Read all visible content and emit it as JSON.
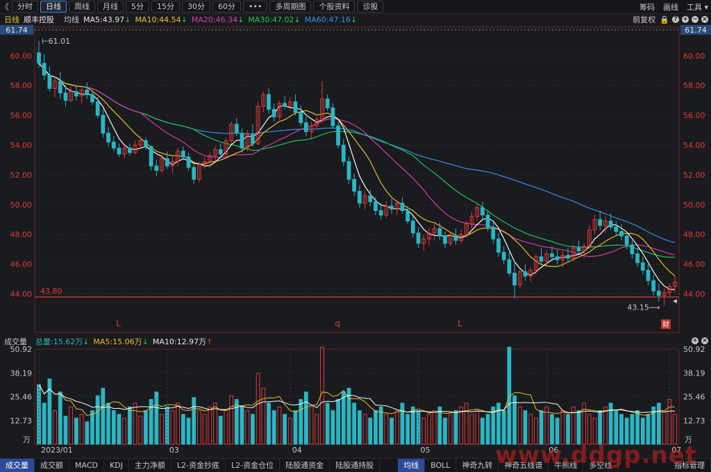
{
  "toolbar": {
    "back": "《",
    "tabs": [
      "分时",
      "日线",
      "周线",
      "月线",
      "5分",
      "15分",
      "30分",
      "60分",
      "•••",
      "多周期图",
      "个股资料",
      "诊股"
    ],
    "active_tab": "日线",
    "right_items": [
      "筹码",
      "画线",
      "工具 ▾"
    ]
  },
  "ma_bar": {
    "period": "日线",
    "stock": "顺丰控股",
    "label": "均线",
    "ma5": "MA5:43.97",
    "ma10": "MA10:44.54",
    "ma20": "MA20:46.34",
    "ma30": "MA30:47.02",
    "ma60": "MA60:47.16",
    "adjust": "前复权"
  },
  "colors": {
    "up": "#e03a3a",
    "down": "#2bb6c4",
    "ma5": "#ffffff",
    "ma10": "#e8c22a",
    "ma20": "#d23ea6",
    "ma30": "#22c55a",
    "ma60": "#3a8ee6",
    "vol_total": "#2bb6c4"
  },
  "price_axis": {
    "ticks": [
      "61.74",
      "60.00",
      "58.00",
      "56.00",
      "54.00",
      "52.00",
      "50.00",
      "48.00",
      "46.00",
      "44.00"
    ],
    "top_label": "61.74"
  },
  "annotations": {
    "high": "61.01",
    "low": "43.15",
    "hline_label": "43.80",
    "markers": [
      "L",
      "q",
      "L"
    ],
    "fin_badge": "财"
  },
  "volume_bar": {
    "label": "成交量",
    "total": "总量:15.62万",
    "ma5": "MA5:15.06万",
    "ma10": "MA10:12.97万"
  },
  "volume_axis": {
    "ticks": [
      "50.92",
      "38.19",
      "25.46",
      "12.73"
    ],
    "unit": "万"
  },
  "x_axis": {
    "labels": [
      "2023/01",
      "03",
      "04",
      "05",
      "06",
      "07",
      "08"
    ]
  },
  "bottom_tabs": [
    "成交量",
    "成交额",
    "MACD",
    "KDJ",
    "主力净额",
    "L2-资金抄底",
    "L2-资金仓位",
    "陆股通资金",
    "陆股通持股",
    "均线",
    "BOLL",
    "神奇九转",
    "神奇五线谱",
    "牛熊线",
    "多空线",
    "指标管理"
  ],
  "watermark": "www.ddgp.net",
  "chart_data": {
    "type": "candlestick",
    "title": "顺丰控股 日线",
    "ylim": [
      43.0,
      61.74
    ],
    "vol_ylim": [
      0,
      50.92
    ],
    "x": [
      "2023/01",
      "",
      "",
      "",
      "",
      "",
      "",
      "",
      "",
      "",
      "",
      "",
      "",
      "",
      "",
      "",
      "",
      "",
      "",
      "",
      "",
      "",
      "",
      "",
      "03",
      "",
      "",
      "",
      "",
      "",
      "",
      "",
      "",
      "",
      "",
      "",
      "",
      "",
      "",
      "",
      "",
      "",
      "",
      "",
      "",
      "",
      "",
      "04",
      "",
      "",
      "",
      "",
      "",
      "",
      "",
      "",
      "",
      "",
      "",
      "",
      "",
      "",
      "",
      "",
      "",
      "",
      "",
      "",
      "",
      "",
      "",
      "05",
      "",
      "",
      "",
      "",
      "",
      "",
      "",
      "",
      "",
      "",
      "",
      "",
      "",
      "",
      "",
      "",
      "",
      "",
      "",
      "",
      "",
      "",
      "",
      "06",
      "",
      "",
      "",
      "",
      "",
      "",
      "",
      "",
      "",
      "",
      "",
      "",
      "",
      "",
      "",
      "",
      "",
      "",
      "",
      "",
      "",
      "",
      "07",
      "",
      "",
      "",
      "",
      "",
      "",
      "",
      "",
      "",
      "",
      "",
      "",
      "",
      "",
      "",
      "",
      "",
      "",
      "",
      "",
      "",
      "",
      "",
      "08",
      "",
      "",
      "",
      "",
      "",
      "",
      "",
      "",
      "",
      "",
      "",
      "",
      "",
      "",
      "",
      "",
      "",
      "",
      "",
      "",
      "",
      "",
      ""
    ],
    "candles": [
      [
        60.2,
        61.0,
        59.2,
        59.5
      ],
      [
        59.5,
        60.1,
        58.4,
        58.7
      ],
      [
        58.7,
        59.3,
        57.6,
        57.8
      ],
      [
        57.8,
        58.6,
        57.2,
        58.3
      ],
      [
        58.3,
        58.9,
        57.1,
        57.5
      ],
      [
        57.5,
        58.0,
        56.6,
        57.0
      ],
      [
        57.0,
        57.9,
        56.9,
        57.6
      ],
      [
        57.6,
        58.0,
        57.0,
        57.3
      ],
      [
        57.3,
        57.8,
        56.8,
        57.7
      ],
      [
        57.7,
        58.2,
        57.1,
        57.4
      ],
      [
        57.4,
        57.7,
        56.7,
        56.9
      ],
      [
        56.9,
        57.2,
        55.8,
        56.0
      ],
      [
        56.0,
        56.4,
        54.5,
        54.8
      ],
      [
        54.8,
        55.2,
        53.9,
        54.2
      ],
      [
        54.2,
        54.6,
        53.6,
        53.8
      ],
      [
        53.8,
        54.1,
        53.2,
        53.4
      ],
      [
        53.4,
        54.0,
        53.1,
        53.8
      ],
      [
        53.8,
        54.1,
        53.3,
        53.5
      ],
      [
        53.5,
        54.3,
        53.4,
        54.0
      ],
      [
        54.0,
        54.6,
        53.7,
        54.3
      ],
      [
        54.3,
        54.5,
        53.7,
        53.9
      ],
      [
        53.9,
        54.0,
        52.3,
        52.6
      ],
      [
        52.6,
        53.0,
        51.9,
        52.3
      ],
      [
        52.3,
        53.4,
        52.1,
        53.1
      ],
      [
        53.1,
        53.6,
        52.4,
        52.6
      ],
      [
        52.6,
        53.3,
        52.1,
        52.9
      ],
      [
        52.9,
        53.8,
        52.6,
        53.6
      ],
      [
        53.6,
        53.9,
        53.0,
        53.2
      ],
      [
        53.2,
        53.5,
        52.3,
        52.5
      ],
      [
        52.5,
        52.8,
        51.4,
        51.7
      ],
      [
        51.7,
        52.9,
        51.5,
        52.7
      ],
      [
        52.7,
        53.2,
        52.4,
        52.9
      ],
      [
        52.9,
        53.5,
        52.5,
        53.3
      ],
      [
        53.3,
        53.9,
        52.9,
        53.7
      ],
      [
        53.7,
        54.1,
        53.1,
        53.4
      ],
      [
        53.4,
        54.5,
        53.2,
        54.3
      ],
      [
        54.3,
        55.6,
        54.1,
        55.4
      ],
      [
        55.4,
        55.8,
        54.6,
        54.8
      ],
      [
        54.8,
        55.1,
        53.5,
        53.8
      ],
      [
        53.8,
        55.0,
        53.6,
        54.7
      ],
      [
        54.7,
        55.4,
        53.9,
        54.1
      ],
      [
        54.1,
        56.9,
        54.0,
        56.6
      ],
      [
        56.6,
        57.6,
        56.2,
        57.4
      ],
      [
        57.4,
        57.8,
        56.1,
        56.4
      ],
      [
        56.4,
        56.8,
        55.6,
        55.9
      ],
      [
        55.9,
        57.0,
        55.7,
        56.8
      ],
      [
        56.8,
        57.3,
        56.4,
        56.6
      ],
      [
        56.6,
        57.2,
        56.3,
        56.9
      ],
      [
        56.9,
        57.4,
        56.0,
        56.2
      ],
      [
        56.2,
        56.7,
        55.3,
        55.5
      ],
      [
        55.5,
        55.9,
        54.6,
        54.9
      ],
      [
        54.9,
        55.6,
        54.4,
        55.3
      ],
      [
        55.3,
        55.9,
        55.1,
        55.7
      ],
      [
        55.7,
        58.3,
        55.6,
        57.1
      ],
      [
        57.1,
        57.4,
        56.3,
        56.5
      ],
      [
        56.5,
        56.8,
        55.1,
        55.3
      ],
      [
        55.3,
        55.6,
        53.8,
        54.0
      ],
      [
        54.0,
        54.4,
        52.6,
        52.9
      ],
      [
        52.9,
        53.2,
        51.4,
        51.7
      ],
      [
        51.7,
        52.1,
        50.6,
        50.9
      ],
      [
        50.9,
        51.3,
        49.8,
        50.1
      ],
      [
        50.1,
        50.9,
        49.7,
        50.6
      ],
      [
        50.6,
        51.0,
        49.9,
        50.2
      ],
      [
        50.2,
        50.5,
        49.3,
        49.6
      ],
      [
        49.6,
        50.1,
        49.0,
        49.3
      ],
      [
        49.3,
        50.2,
        49.1,
        49.9
      ],
      [
        49.9,
        50.4,
        49.4,
        49.7
      ],
      [
        49.7,
        50.3,
        49.3,
        50.1
      ],
      [
        50.1,
        50.5,
        49.4,
        49.6
      ],
      [
        49.6,
        49.9,
        48.7,
        48.9
      ],
      [
        48.9,
        49.2,
        47.8,
        48.1
      ],
      [
        48.1,
        48.5,
        47.1,
        47.4
      ],
      [
        47.4,
        48.0,
        46.9,
        47.7
      ],
      [
        47.7,
        48.4,
        47.3,
        48.1
      ],
      [
        48.1,
        48.7,
        47.6,
        48.4
      ],
      [
        48.4,
        48.8,
        47.6,
        47.9
      ],
      [
        47.9,
        48.2,
        47.1,
        47.4
      ],
      [
        47.4,
        48.1,
        47.2,
        47.9
      ],
      [
        47.9,
        48.4,
        47.3,
        47.6
      ],
      [
        47.6,
        48.3,
        47.4,
        48.0
      ],
      [
        48.0,
        48.9,
        47.8,
        48.7
      ],
      [
        48.7,
        49.5,
        48.4,
        49.2
      ],
      [
        49.2,
        50.1,
        48.9,
        49.8
      ],
      [
        49.8,
        50.2,
        49.0,
        49.3
      ],
      [
        49.3,
        49.6,
        48.2,
        48.5
      ],
      [
        48.5,
        48.8,
        47.4,
        47.7
      ],
      [
        47.7,
        48.1,
        46.5,
        46.8
      ],
      [
        46.8,
        47.2,
        46.0,
        46.3
      ],
      [
        46.3,
        46.8,
        45.2,
        45.4
      ],
      [
        45.4,
        46.2,
        43.7,
        44.6
      ],
      [
        44.6,
        45.7,
        44.4,
        45.5
      ],
      [
        45.5,
        46.0,
        44.9,
        45.2
      ],
      [
        45.2,
        45.8,
        44.8,
        45.6
      ],
      [
        45.6,
        46.7,
        45.3,
        46.5
      ],
      [
        46.5,
        47.1,
        46.0,
        46.2
      ],
      [
        46.2,
        46.9,
        45.9,
        46.7
      ],
      [
        46.7,
        47.2,
        46.2,
        46.5
      ],
      [
        46.5,
        47.0,
        46.0,
        46.3
      ],
      [
        46.3,
        46.9,
        45.8,
        46.6
      ],
      [
        46.6,
        47.1,
        46.1,
        46.4
      ],
      [
        46.4,
        47.3,
        46.2,
        47.1
      ],
      [
        47.1,
        47.6,
        46.7,
        46.9
      ],
      [
        46.9,
        47.4,
        46.4,
        47.2
      ],
      [
        47.2,
        48.6,
        47.0,
        48.3
      ],
      [
        48.3,
        49.3,
        48.0,
        49.0
      ],
      [
        49.0,
        49.6,
        48.3,
        48.6
      ],
      [
        48.6,
        49.2,
        48.1,
        48.9
      ],
      [
        48.9,
        49.4,
        48.3,
        48.5
      ],
      [
        48.5,
        48.9,
        47.9,
        48.2
      ],
      [
        48.2,
        48.7,
        47.6,
        47.9
      ],
      [
        47.9,
        48.2,
        47.0,
        47.3
      ],
      [
        47.3,
        47.6,
        46.4,
        46.7
      ],
      [
        46.7,
        47.1,
        45.8,
        46.1
      ],
      [
        46.1,
        46.5,
        45.3,
        45.6
      ],
      [
        45.6,
        46.0,
        44.6,
        44.9
      ],
      [
        44.9,
        45.3,
        43.9,
        44.2
      ],
      [
        44.2,
        44.7,
        43.5,
        43.9
      ],
      [
        43.9,
        44.4,
        43.2,
        44.1
      ],
      [
        44.1,
        44.7,
        43.8,
        44.5
      ],
      [
        44.5,
        45.2,
        44.1,
        44.8
      ]
    ],
    "series": [
      {
        "name": "MA5",
        "values": [
          43.97
        ]
      },
      {
        "name": "MA10",
        "values": [
          44.54
        ]
      },
      {
        "name": "MA20",
        "values": [
          46.34
        ]
      },
      {
        "name": "MA30",
        "values": [
          47.02
        ]
      },
      {
        "name": "MA60",
        "values": [
          47.16
        ]
      }
    ],
    "volume": [
      32,
      22,
      35,
      18,
      28,
      15,
      20,
      14,
      16,
      12,
      18,
      26,
      30,
      22,
      18,
      16,
      14,
      20,
      22,
      15,
      18,
      24,
      28,
      16,
      20,
      18,
      22,
      16,
      14,
      25,
      18,
      16,
      20,
      22,
      15,
      18,
      26,
      24,
      20,
      18,
      16,
      38,
      30,
      22,
      18,
      20,
      16,
      14,
      18,
      24,
      28,
      20,
      16,
      52,
      22,
      18,
      24,
      28,
      30,
      22,
      18,
      16,
      14,
      18,
      20,
      16,
      14,
      18,
      22,
      16,
      20,
      18,
      14,
      16,
      18,
      20,
      14,
      16,
      18,
      20,
      22,
      16,
      18,
      14,
      16,
      20,
      22,
      18,
      52,
      26,
      20,
      18,
      16,
      14,
      18,
      20,
      16,
      14,
      18,
      16,
      20,
      18,
      22,
      16,
      14,
      18,
      20,
      22,
      18,
      16,
      14,
      16,
      18,
      14,
      16,
      20,
      22,
      18,
      24,
      16
    ]
  }
}
